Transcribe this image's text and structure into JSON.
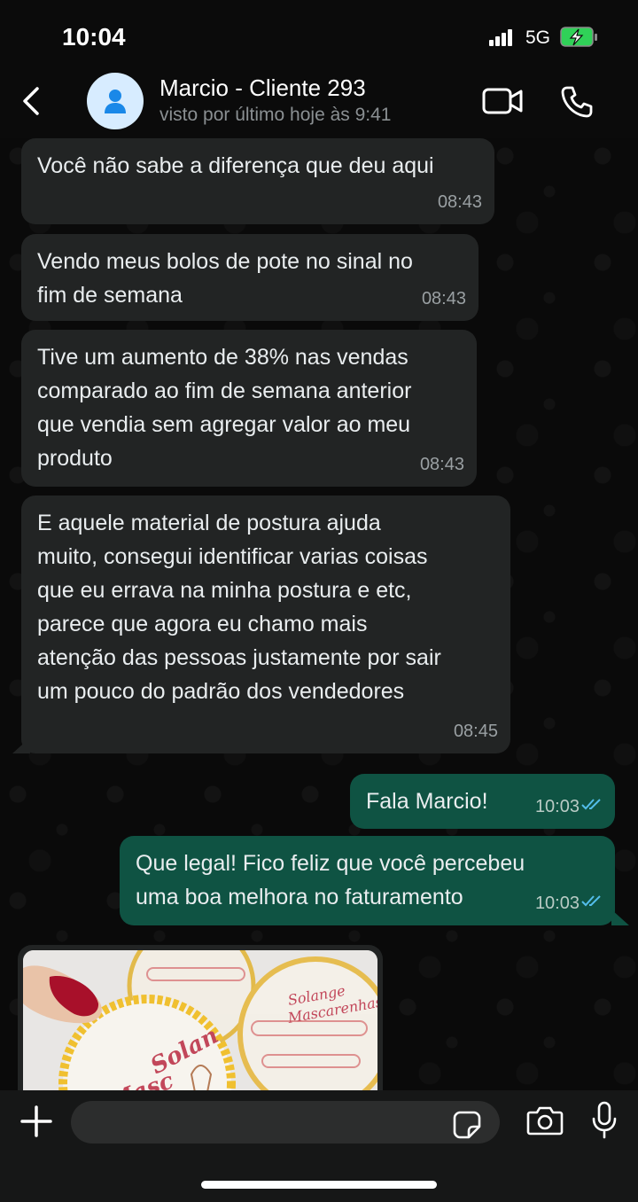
{
  "status_bar": {
    "time": "10:04",
    "network": "5G",
    "battery_charging": true
  },
  "header": {
    "contact_name": "Marcio - Cliente 293",
    "contact_status": "visto por último hoje às 9:41",
    "icons": {
      "back": "chevron-left-icon",
      "avatar": "user-icon",
      "video": "video-camera-icon",
      "call": "phone-icon"
    }
  },
  "messages": [
    {
      "direction": "in",
      "text": "Você não sabe a diferença que deu aqui",
      "time": "08:43"
    },
    {
      "direction": "in",
      "text": "Vendo meus bolos de pote no sinal no\nfim de semana",
      "time": "08:43"
    },
    {
      "direction": "in",
      "text": "Tive um aumento de 38% nas vendas\ncomparado ao fim de semana anterior\nque vendia sem agregar valor ao meu\nproduto",
      "time": "08:43"
    },
    {
      "direction": "in",
      "text": "E aquele material de postura ajuda\nmuito, consegui identificar varias coisas\nque eu errava na minha postura e etc,\nparece que agora eu chamo mais\natenção das pessoas justamente por sair\num pouco do padrão dos vendedores",
      "time": "08:45"
    },
    {
      "direction": "out",
      "text": "Fala Marcio!",
      "time": "10:03",
      "status": "read"
    },
    {
      "direction": "out",
      "text": "Que legal! Fico feliz que você percebeu\numa boa melhora no faturamento",
      "time": "10:03",
      "status": "read"
    }
  ],
  "image_message": {
    "description_icon": "sticker-labels-photo",
    "label_text": [
      "Solange",
      "Mascarenhas"
    ]
  },
  "composer": {
    "placeholder": "",
    "icons": {
      "attach": "plus-icon",
      "sticker": "sticker-icon",
      "camera": "camera-icon",
      "mic": "microphone-icon"
    }
  },
  "colors": {
    "incoming_bubble": "#222424",
    "outgoing_bubble": "#0f5343",
    "read_ticks": "#53bdeb",
    "background": "#0b0b0b"
  }
}
